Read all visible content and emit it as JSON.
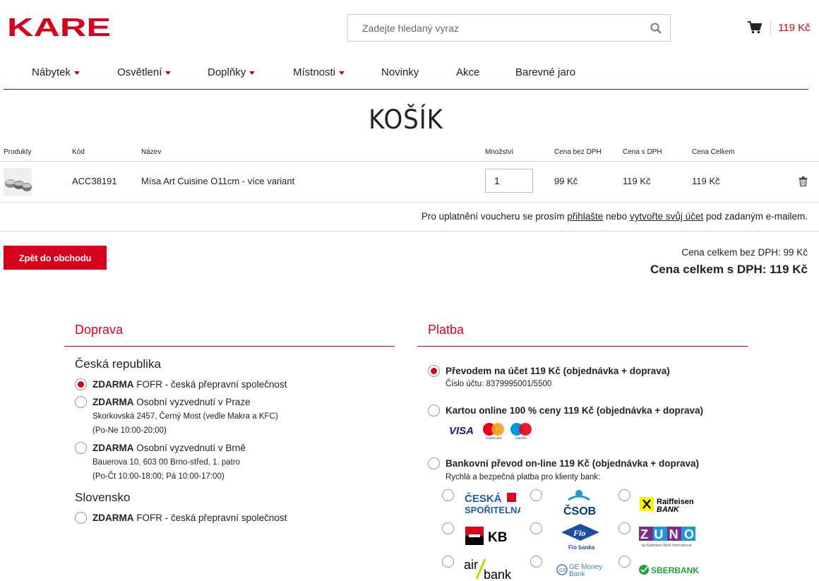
{
  "header": {
    "logo_text": "KARE",
    "search_placeholder": "Zadejte hledaný vyraz",
    "cart_total": "119 Kč"
  },
  "nav": [
    {
      "label": "Nábytek",
      "dropdown": true
    },
    {
      "label": "Osvětlení",
      "dropdown": true
    },
    {
      "label": "Doplňky",
      "dropdown": true
    },
    {
      "label": "Místnosti",
      "dropdown": true
    },
    {
      "label": "Novinky",
      "dropdown": false
    },
    {
      "label": "Akce",
      "dropdown": false
    },
    {
      "label": "Barevné jaro",
      "dropdown": false
    }
  ],
  "page_title": "KOŠÍK",
  "table": {
    "headers": [
      "Produkty",
      "Kód",
      "Název",
      "Množství",
      "Cena bez DPH",
      "Cena s DPH",
      "Cena Celkem"
    ],
    "rows": [
      {
        "code": "ACC38191",
        "name": "Mísa Art Cuisine O11cm - více variant",
        "quantity": "1",
        "price_no_vat": "99 Kč",
        "price_vat": "119 Kč",
        "total": "119 Kč"
      }
    ]
  },
  "voucher": {
    "text1": "Pro uplatnění voucheru se prosím",
    "link1": "přihlašte",
    "text2": "nebo",
    "link2": "vytvořte svůj účet",
    "text3": "pod zadaným e-mailem."
  },
  "back_button": "Zpět do obchodu",
  "summary": {
    "without_vat": "Cena celkem bez DPH: 99 Kč",
    "with_vat": "Cena celkem s DPH: 119 Kč"
  },
  "shipping": {
    "title": "Doprava",
    "cz_label": "Česká republika",
    "sk_label": "Slovensko",
    "options": [
      {
        "bold": "ZDARMA",
        "text": "FOFR - česká přepravní společnost",
        "checked": true
      },
      {
        "bold": "ZDARMA",
        "text": "Osobní vyzvednutí v Praze",
        "line2": "Skorkovská 2457, Černý Most (vedle Makra a KFC)",
        "line3": "(Po-Ne 10:00-20:00)",
        "checked": false
      },
      {
        "bold": "ZDARMA",
        "text": "Osobní vyzvednutí v Brně",
        "line2": "Bauerova 10, 603 00 Brno-střed, 1. patro",
        "line3": "(Po-Čt 10:00-18:00; Pá 10:00-17:00)",
        "checked": false
      },
      {
        "bold": "ZDARMA",
        "text": "FOFR - česká přepravní společnost",
        "checked": false
      }
    ]
  },
  "payment": {
    "title": "Platba",
    "options": [
      {
        "label": "Převodem na účet 119 Kč (objednávka + doprava)",
        "sub": "Číslo účtu: 8379995001/5500",
        "checked": true
      },
      {
        "label": "Kartou online 100 % ceny 119 Kč (objednávka + doprava)",
        "checked": false
      },
      {
        "label": "Bankovní převod on-line 119 Kč (objednávka + doprava)",
        "sub": "Rychlá a bezpečná platba pro klienty bank:",
        "checked": false
      }
    ],
    "cards": {
      "visa": "VISA",
      "mastercard": "mastercard",
      "maestro": "maestro"
    },
    "banks": {
      "cs_line1": "ČESKÁ",
      "cs_line2": "SPOŘITELNA",
      "csob": "ČSOB",
      "raif_line1": "Raiffeisen",
      "raif_line2": "BANK",
      "kb": "KB",
      "fio": "Fio banka",
      "zuno": "ZUNO",
      "zuno_sub": "by Raiffeisen Bank International",
      "air1": "air",
      "air2": "bank",
      "ge_line1": "GE Money",
      "ge_line2": "Bank",
      "sber": "SBERBANK"
    }
  },
  "colors": {
    "accent": "#d6001c"
  }
}
